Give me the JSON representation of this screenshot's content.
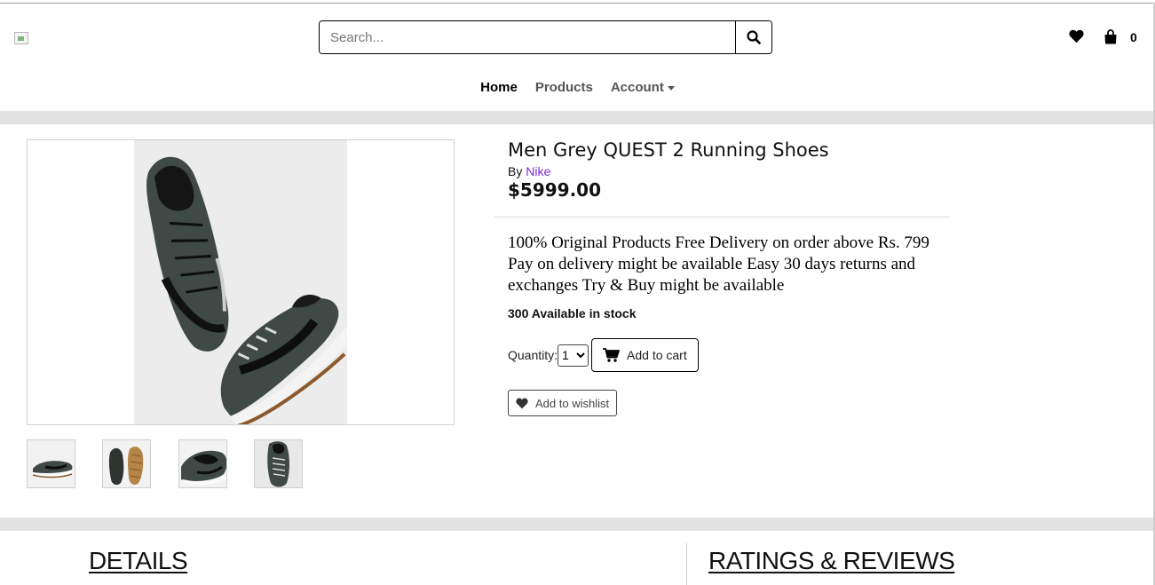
{
  "header": {
    "search": {
      "placeholder": "Search...",
      "value": ""
    },
    "cart_count": "0"
  },
  "nav": {
    "items": [
      {
        "label": "Home",
        "active": true
      },
      {
        "label": "Products",
        "active": false
      },
      {
        "label": "Account",
        "active": false
      }
    ]
  },
  "product": {
    "title": "Men Grey QUEST 2 Running Shoes",
    "by_label": "By",
    "brand": "Nike",
    "price": "$5999.00",
    "description": "100% Original Products Free Delivery on order above Rs. 799 Pay on delivery might be available Easy 30 days returns and exchanges Try & Buy might be available",
    "stock": "300 Available in stock",
    "quantity_label": "Quantity:",
    "quantity_value": "1",
    "add_to_cart_label": "Add to cart",
    "add_to_wishlist_label": "Add to wishlist"
  },
  "sections": {
    "details": "DETAILS",
    "reviews": "RATINGS & REVIEWS"
  },
  "colors": {
    "brand_link": "#7a2ad6",
    "band": "#e2e2e2",
    "shoe_upper": "#4a5450",
    "shoe_sole": "#8a5a2b"
  }
}
